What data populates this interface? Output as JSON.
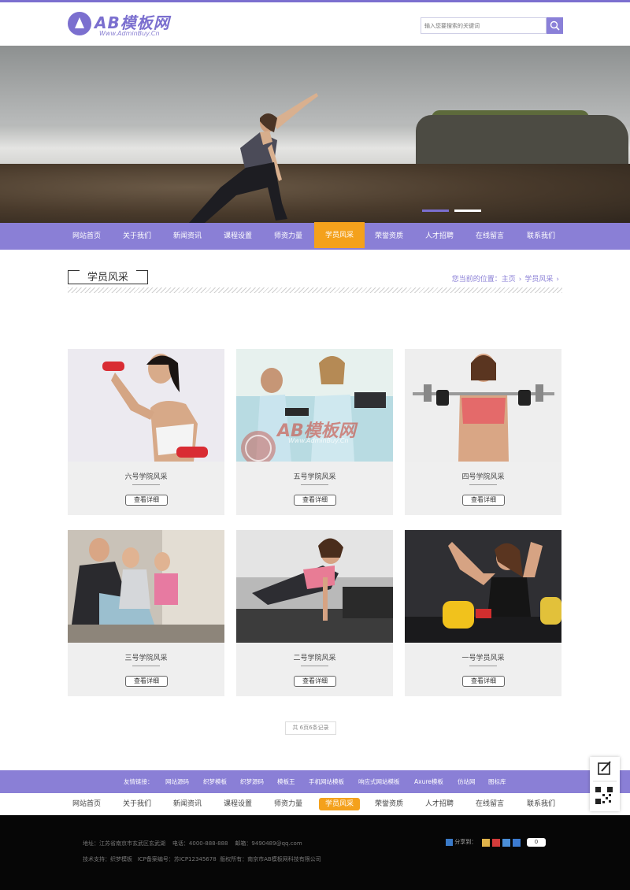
{
  "header": {
    "logo_text": "AB模板网",
    "logo_sub": "Www.AdminBuy.Cn",
    "search_placeholder": "输入您要搜索的关键词"
  },
  "nav": [
    {
      "label": "网站首页",
      "active": false
    },
    {
      "label": "关于我们",
      "active": false
    },
    {
      "label": "新闻资讯",
      "active": false
    },
    {
      "label": "课程设置",
      "active": false
    },
    {
      "label": "师资力量",
      "active": false
    },
    {
      "label": "学员风采",
      "active": true
    },
    {
      "label": "荣誉资质",
      "active": false
    },
    {
      "label": "人才招聘",
      "active": false
    },
    {
      "label": "在线留言",
      "active": false
    },
    {
      "label": "联系我们",
      "active": false
    }
  ],
  "section": {
    "title": "学员风采",
    "crumb_prefix": "您当前的位置：",
    "crumb_home": "主页",
    "crumb_current": "学员风采"
  },
  "cards": [
    {
      "title": "六号学院风采",
      "button": "查看详细"
    },
    {
      "title": "五号学院风采",
      "button": "查看详细"
    },
    {
      "title": "四号学院风采",
      "button": "查看详细"
    },
    {
      "title": "三号学院风采",
      "button": "查看详细"
    },
    {
      "title": "二号学院风采",
      "button": "查看详细"
    },
    {
      "title": "一号学员风采",
      "button": "查看详细"
    }
  ],
  "watermark": {
    "text": "AB模板网",
    "sub": "Www.AdminBuy.Cn"
  },
  "pager": "共 6页6条记录",
  "friend_links": {
    "label": "友情链接：",
    "items": [
      "网站源码",
      "织梦模板",
      "织梦源码",
      "模板王",
      "手机网站模板",
      "响应式网站模板",
      "Axure模板",
      "仿站网",
      "图标库"
    ]
  },
  "footer": {
    "address_label": "地址：江苏省南京市玄武区玄武湖",
    "phone": "电话：4000-888-888",
    "email": "邮箱：9490489@qq.com",
    "support": "技术支持：织梦模板",
    "icp": "ICP备案编号：苏ICP12345678",
    "copyright": "版权所有：南京市AB模板网科技有限公司",
    "share_label": "分享到：",
    "share_count": "0"
  }
}
